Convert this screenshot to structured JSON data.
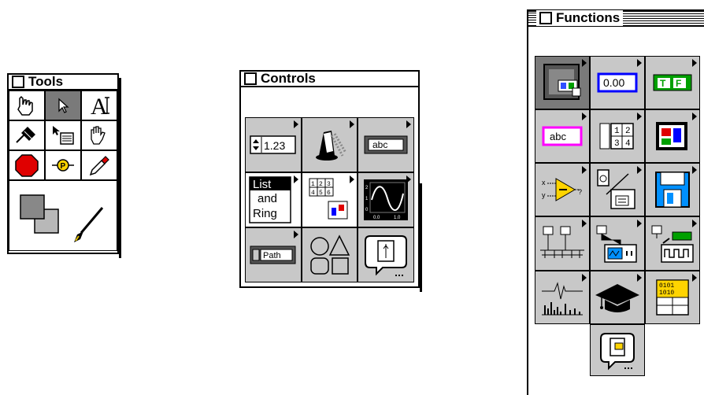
{
  "tools": {
    "title": "Tools"
  },
  "controls": {
    "title": "Controls",
    "numeric_value": "1.23",
    "string_value": "abc",
    "list_ring_label": [
      "List",
      "and",
      "Ring"
    ],
    "array_digits": [
      "1",
      "2",
      "3",
      "4",
      "5",
      "6"
    ],
    "graph_axis": [
      "0.0",
      "1.0",
      "2",
      "1",
      "0"
    ],
    "path_label": "Path"
  },
  "functions": {
    "title": "Functions",
    "numeric_value": "0.00",
    "boolean_t": "T",
    "boolean_f": "F",
    "string_value": "abc",
    "array_cells": [
      "1",
      "2",
      "3",
      "4"
    ],
    "compare_x": "x",
    "compare_y": "y",
    "compare_q": "?",
    "bits": "0101 1010"
  },
  "colors": {
    "palette_gray": "#c8c8c8",
    "stop_red": "#e00000",
    "probe_yellow": "#ffd400",
    "numeric_blue": "#0000ff",
    "boolean_green": "#00a000",
    "string_magenta": "#ff00ff",
    "file_blue": "#0090ff"
  }
}
